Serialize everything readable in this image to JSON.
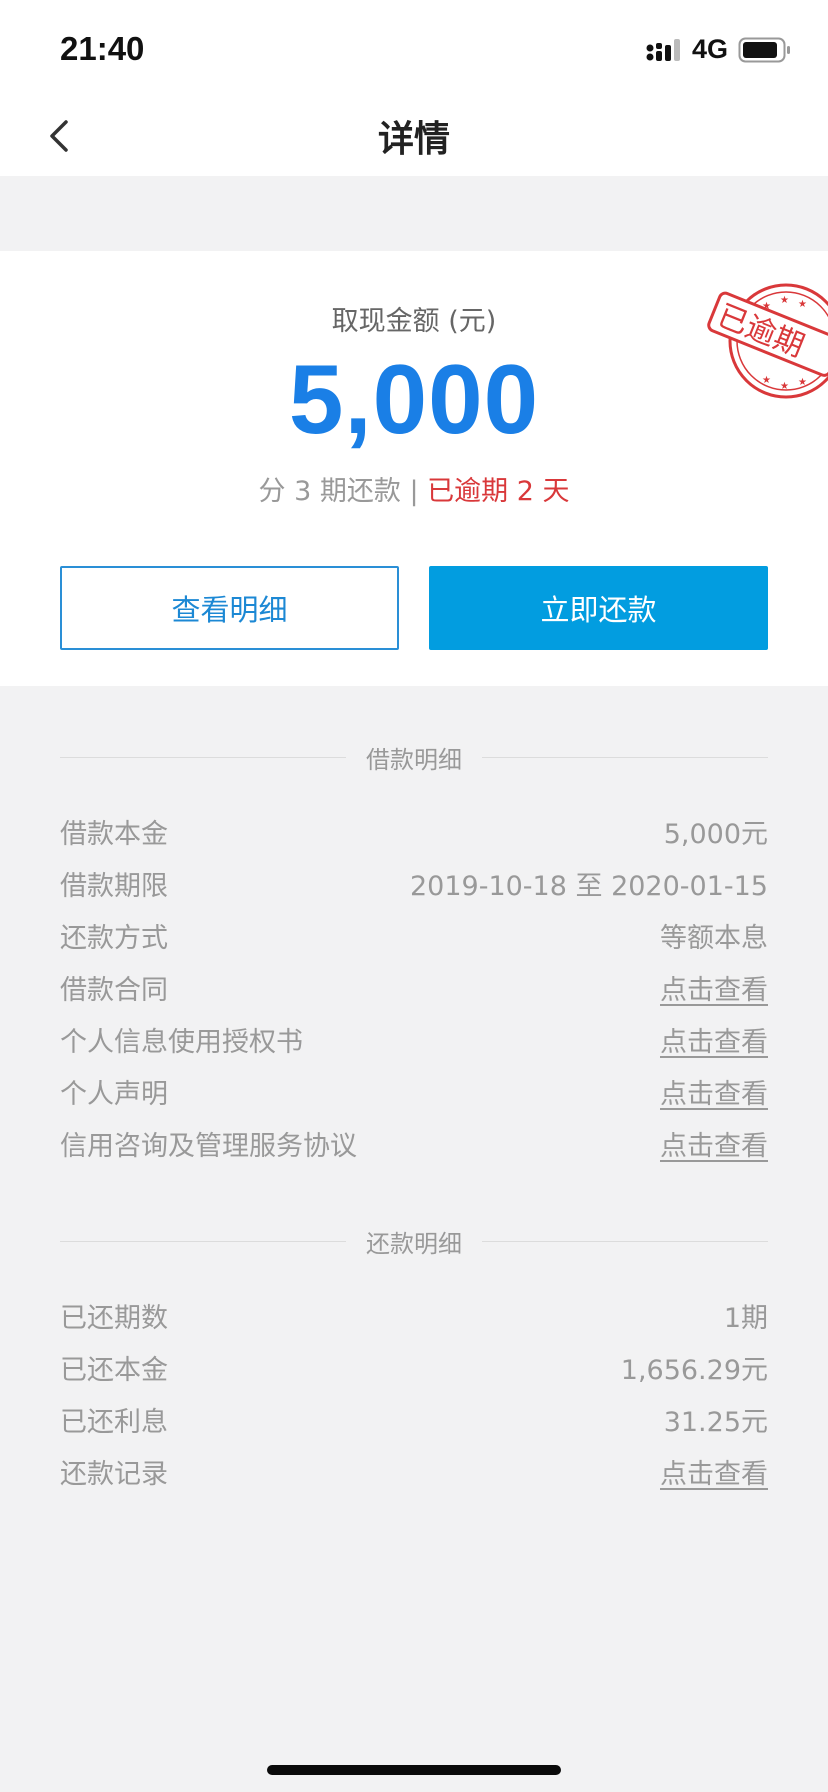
{
  "status_bar": {
    "time": "21:40",
    "network": "4G"
  },
  "nav": {
    "title": "详情"
  },
  "summary": {
    "amount_label": "取现金额 (元)",
    "amount": "5,000",
    "installment_text": "分 3 期还款 |",
    "overdue_text": "已逾期 2 天",
    "stamp_text": "已逾期",
    "stamp_color": "#d9383a"
  },
  "buttons": {
    "detail": "查看明细",
    "repay": "立即还款"
  },
  "loan_section": {
    "title": "借款明细",
    "rows": [
      {
        "label": "借款本金",
        "value": "5,000元"
      },
      {
        "label": "借款期限",
        "value": "2019-10-18 至 2020-01-15"
      },
      {
        "label": "还款方式",
        "value": "等额本息"
      },
      {
        "label": "借款合同",
        "value": "点击查看"
      },
      {
        "label": "个人信息使用授权书",
        "value": "点击查看"
      },
      {
        "label": "个人声明",
        "value": "点击查看"
      },
      {
        "label": "信用咨询及管理服务协议",
        "value": "点击查看"
      }
    ]
  },
  "repay_section": {
    "title": "还款明细",
    "rows": [
      {
        "label": "已还期数",
        "value": "1期"
      },
      {
        "label": "已还本金",
        "value": "1,656.29元"
      },
      {
        "label": "已还利息",
        "value": "31.25元"
      },
      {
        "label": "还款记录",
        "value": "点击查看"
      }
    ]
  },
  "colors": {
    "accent": "#1a7fe6",
    "button": "#029de0",
    "overdue": "#d9383a"
  }
}
